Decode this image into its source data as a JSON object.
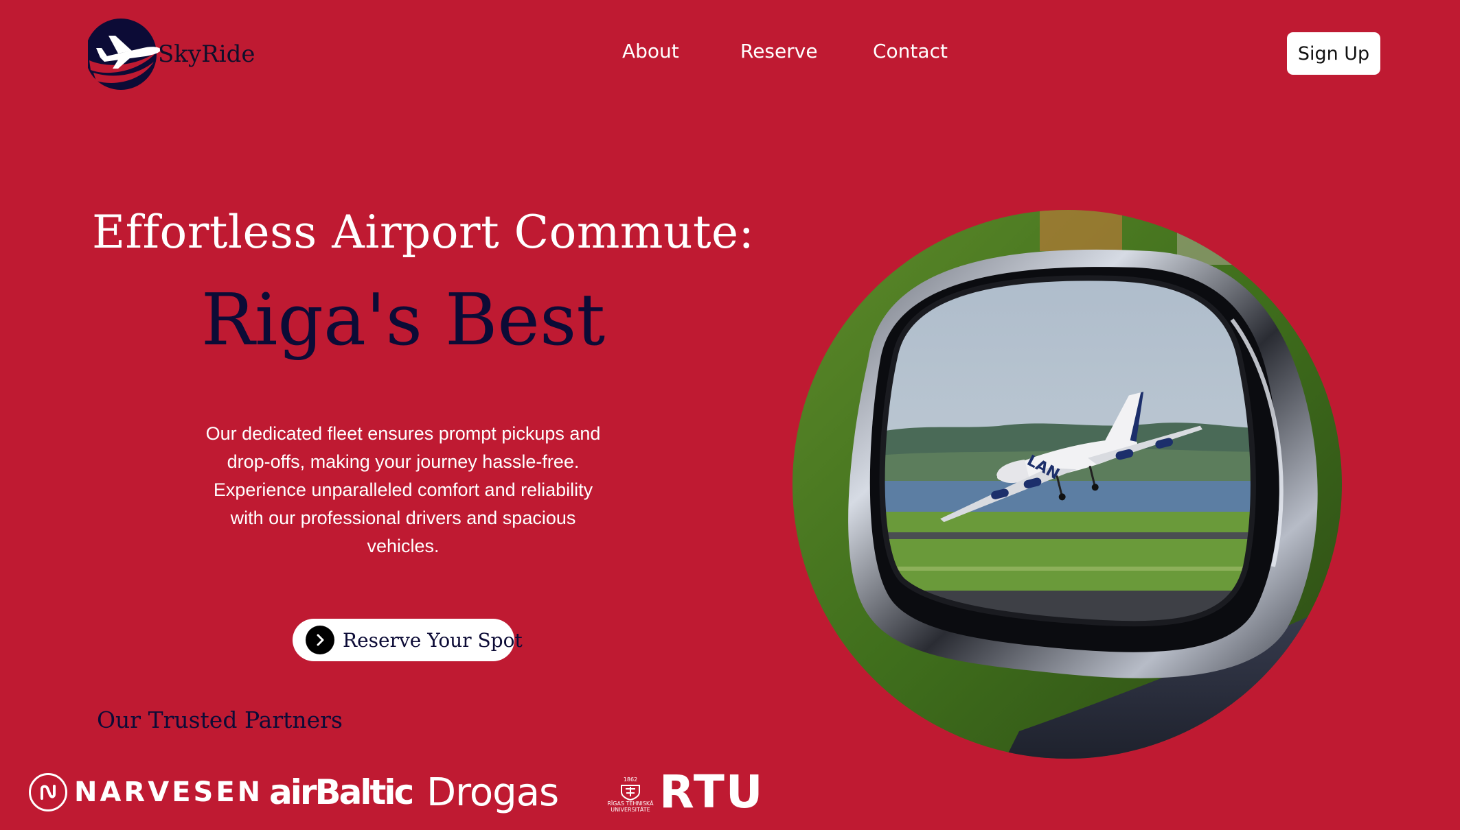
{
  "brand": {
    "name": "SkyRide",
    "colors": {
      "background": "#bf1a32",
      "navy": "#0c0b36",
      "white": "#ffffff"
    }
  },
  "nav": {
    "items": [
      {
        "label": "About"
      },
      {
        "label": "Reserve"
      },
      {
        "label": "Contact"
      }
    ],
    "signup_label": "Sign Up"
  },
  "hero": {
    "title": "Effortless Airport Commute:",
    "accent": "Riga's Best",
    "description": "Our dedicated fleet ensures prompt pickups and drop-offs, making your journey hassle-free. Experience unparalleled comfort and reliability with our professional drivers and spacious vehicles.",
    "cta_label": "Reserve Your Spot",
    "cta_icon": "chevron-right-icon",
    "image": {
      "subject": "airplane-in-side-mirror",
      "aircraft_livery": "LAN"
    }
  },
  "partners": {
    "heading": "Our Trusted Partners",
    "items": [
      {
        "name": "NARVESEN"
      },
      {
        "name": "airBaltic"
      },
      {
        "name": "Drogas"
      },
      {
        "name": "RTU",
        "seal_year": "1862",
        "seal_text": "RĪGAS TEHNISKĀ UNIVERSITĀTE"
      }
    ]
  }
}
